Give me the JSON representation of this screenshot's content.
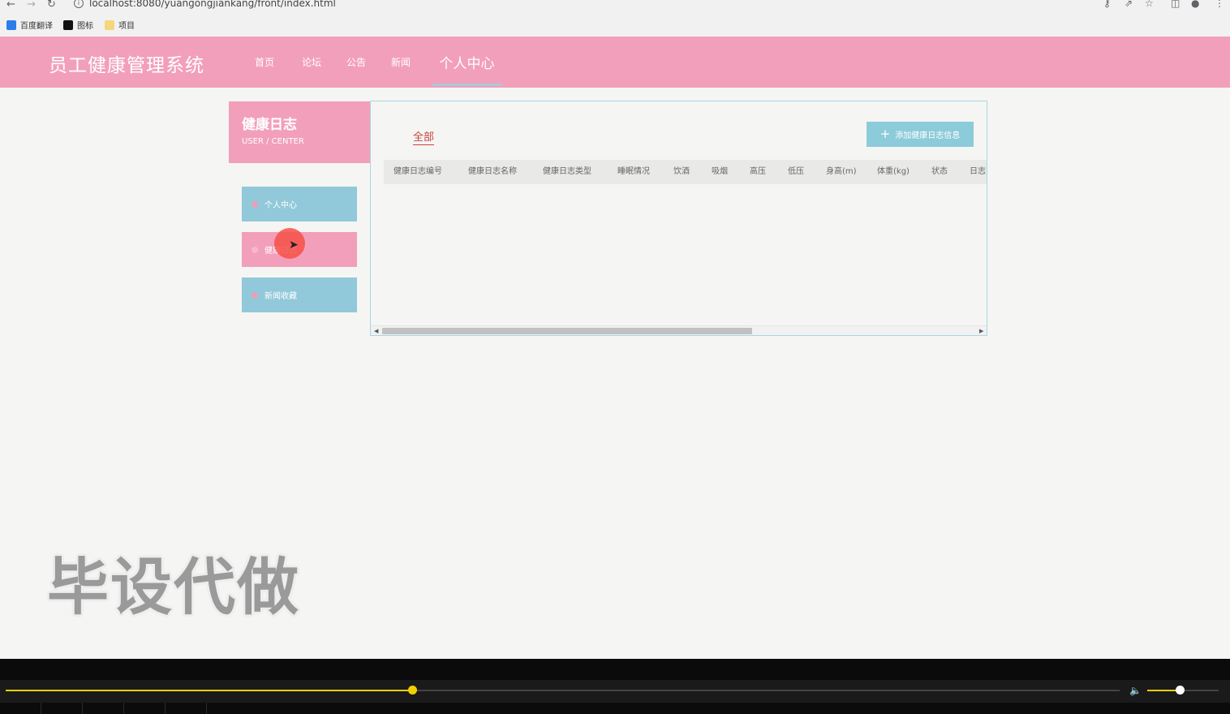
{
  "browser": {
    "url": "localhost:8080/yuangongjiankang/front/index.html",
    "bookmarks": [
      {
        "label": "百度翻译",
        "color": "#2b7de9"
      },
      {
        "label": "图标",
        "color": "#111111"
      },
      {
        "label": "项目",
        "color": "#f5c842"
      }
    ]
  },
  "header": {
    "brand": "员工健康管理系统",
    "nav": [
      {
        "label": "首页"
      },
      {
        "label": "论坛"
      },
      {
        "label": "公告"
      },
      {
        "label": "新闻"
      },
      {
        "label": "个人中心",
        "active": true
      }
    ]
  },
  "sidebar": {
    "title": "健康日志",
    "subtitle": "USER / CENTER",
    "items": [
      {
        "label": "个人中心"
      },
      {
        "label": "健康日志",
        "active": true
      },
      {
        "label": "新闻收藏"
      }
    ]
  },
  "main": {
    "tab_all": "全部",
    "add_button": "添加健康日志信息",
    "columns": [
      "健康日志编号",
      "健康日志名称",
      "健康日志类型",
      "睡眠情况",
      "饮酒",
      "吸烟",
      "高压",
      "低压",
      "身高(m)",
      "体重(kg)",
      "状态",
      "日志"
    ]
  },
  "watermark": "毕设代做",
  "player": {
    "progress": 0.365,
    "volume": 0.45
  },
  "colors": {
    "accent_pink": "#f29fbb",
    "accent_blue": "#92c9da",
    "link_red": "#c7443e",
    "player_yellow": "#f0d000"
  }
}
